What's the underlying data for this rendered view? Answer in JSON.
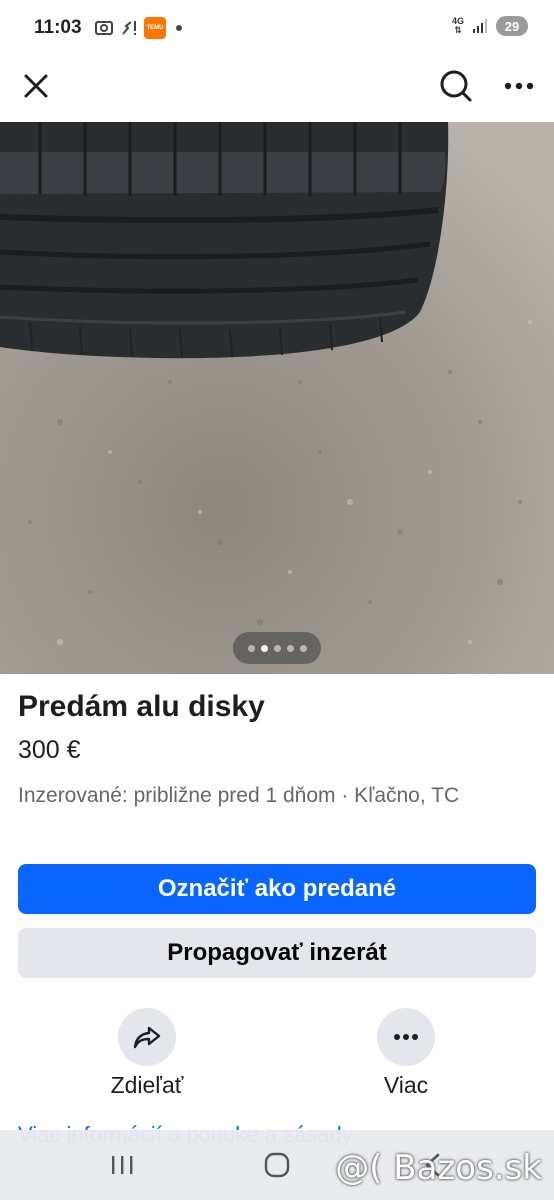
{
  "status_bar": {
    "time": "11:03",
    "temu_badge": "TEMU",
    "network": "4G",
    "battery": "29"
  },
  "listing": {
    "title": "Predám alu disky",
    "price": "300 €",
    "meta": "Inzerované: približne pred 1 dňom · Kľačno, TC",
    "photo_index": 2,
    "photo_count": 5
  },
  "buttons": {
    "mark_sold": "Označiť ako predané",
    "promote": "Propagovať inzerát"
  },
  "actions": {
    "share": "Zdieľať",
    "more": "Viac"
  },
  "more_info_link": "Viac informácií o ponuke a zásady",
  "watermark": "@( Bazos.sk",
  "icons": {
    "close": "close-icon",
    "search": "search-icon",
    "menu": "more-icon",
    "share": "share-icon",
    "more": "dots-icon"
  },
  "colors": {
    "primary": "#0866ff",
    "secondary": "#e4e6eb",
    "muted_text": "#65676b"
  }
}
